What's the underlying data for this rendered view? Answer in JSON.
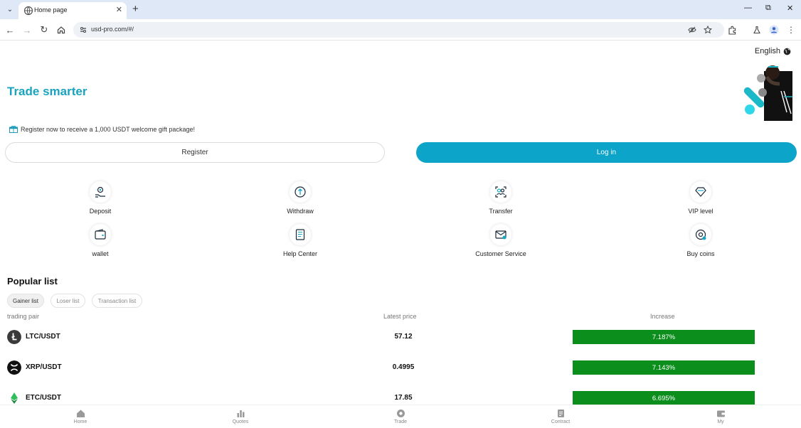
{
  "browser": {
    "tab_title": "Home page",
    "url": "usd-pro.com/#/"
  },
  "page": {
    "language": "English",
    "hero_title": "Trade smarter",
    "promo_text": "Register now to receive a 1,000 USDT welcome gift package!",
    "register_label": "Register",
    "login_label": "Log in",
    "actions": [
      {
        "label": "Deposit",
        "icon": "deposit-icon"
      },
      {
        "label": "Withdraw",
        "icon": "withdraw-icon"
      },
      {
        "label": "Transfer",
        "icon": "transfer-icon"
      },
      {
        "label": "VIP level",
        "icon": "diamond-icon"
      },
      {
        "label": "wallet",
        "icon": "wallet-icon"
      },
      {
        "label": "Help Center",
        "icon": "book-icon"
      },
      {
        "label": "Customer Service",
        "icon": "mail-icon"
      },
      {
        "label": "Buy coins",
        "icon": "coin-icon"
      }
    ],
    "popular": {
      "title": "Popular list",
      "tabs": [
        "Gainer list",
        "Loser list",
        "Transaction list"
      ],
      "active_tab": "Gainer list",
      "columns": [
        "trading pair",
        "Latest price",
        "Increase"
      ],
      "rows": [
        {
          "pair": "LTC/USDT",
          "price": "57.12",
          "increase": "7.187%",
          "logo": "litecoin-icon"
        },
        {
          "pair": "XRP/USDT",
          "price": "0.4995",
          "increase": "7.143%",
          "logo": "xrp-icon"
        },
        {
          "pair": "ETC/USDT",
          "price": "17.85",
          "increase": "6.695%",
          "logo": "ethereum-classic-icon"
        }
      ]
    },
    "bottom_nav": [
      "Home",
      "Quotes",
      "Trade",
      "Contract",
      "My"
    ]
  },
  "colors": {
    "accent": "#1aa3c0",
    "login_button": "#0ca4c8",
    "increase_bg": "#0b8e1c"
  }
}
